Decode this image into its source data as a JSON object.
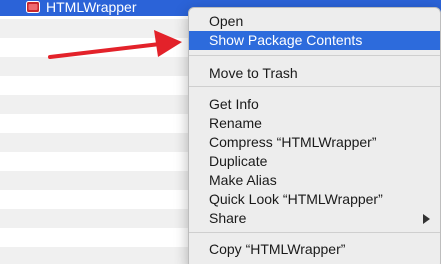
{
  "file_list": {
    "selected_item": {
      "name": "HTMLWrapper",
      "icon": "application-icon"
    },
    "selection_color": "#2b63d8",
    "stripe_color": "#f0f0f0"
  },
  "context_menu": {
    "highlight_color": "#2d6bdc",
    "items": [
      {
        "label": "Open"
      },
      {
        "label": "Show Package Contents",
        "highlighted": true
      },
      {
        "label": "Move to Trash"
      },
      {
        "label": "Get Info"
      },
      {
        "label": "Rename"
      },
      {
        "label": "Compress “HTMLWrapper”"
      },
      {
        "label": "Duplicate"
      },
      {
        "label": "Make Alias"
      },
      {
        "label": "Quick Look “HTMLWrapper”"
      },
      {
        "label": "Share",
        "submenu": true
      },
      {
        "label": "Copy “HTMLWrapper”"
      }
    ]
  },
  "annotation": {
    "arrow_color": "#e3222a"
  }
}
